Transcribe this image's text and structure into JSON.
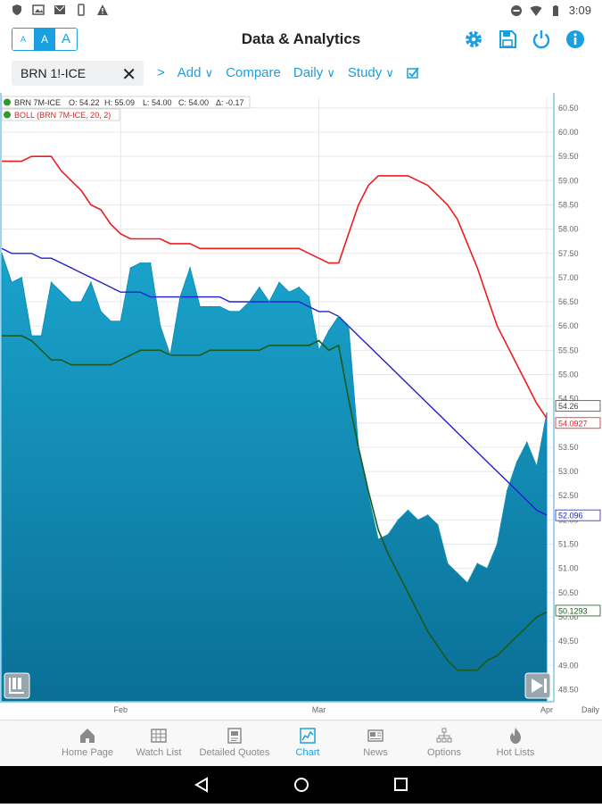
{
  "status_bar": {
    "time": "3:09"
  },
  "app": {
    "title": "Data & Analytics",
    "font_sizes": [
      "A",
      "A",
      "A"
    ],
    "actions": [
      "gear-icon",
      "save-icon",
      "power-icon",
      "info-icon"
    ]
  },
  "toolbar": {
    "symbol_value": "BRN 1!-ICE",
    "next_label": ">",
    "add_label": "Add",
    "compare_label": "Compare",
    "interval_label": "Daily",
    "study_label": "Study"
  },
  "chart": {
    "legend": [
      {
        "label": "BRN 7M-ICE",
        "o": "O: 54.22",
        "h": "H: 55.09",
        "l": "L: 54.00",
        "c": "C: 54.00",
        "chg": "Δ: -0.17",
        "color": "#222222"
      },
      {
        "label": "BOLL (BRN 7M-ICE, 20, 2)",
        "color": "#e02020"
      }
    ],
    "y_ticks": [
      "60.50",
      "60.00",
      "59.50",
      "59.00",
      "58.50",
      "58.00",
      "57.50",
      "57.00",
      "56.50",
      "56.00",
      "55.50",
      "55.00",
      "54.50",
      "54.00",
      "53.50",
      "53.00",
      "52.50",
      "52.00",
      "51.50",
      "51.00",
      "50.50",
      "50.00",
      "49.50",
      "49.00",
      "48.50"
    ],
    "x_ticks": [
      "Feb",
      "Mar",
      "Apr"
    ],
    "interval_tag": "Daily",
    "price_tags": {
      "last": "54.26",
      "upper": "54.0927",
      "middle": "52.096",
      "lower": "50.1293"
    },
    "colors": {
      "area": "#1aa3cc",
      "upper": "#ee1c1c",
      "middle": "#2020d0",
      "lower": "#1a5a1a"
    }
  },
  "chart_data": {
    "type": "area",
    "x": [
      "Jan 16",
      "Jan 17",
      "Jan 18",
      "Jan 19",
      "Jan 20",
      "Jan 23",
      "Jan 24",
      "Jan 25",
      "Jan 26",
      "Jan 27",
      "Jan 30",
      "Jan 31",
      "Feb 1",
      "Feb 2",
      "Feb 3",
      "Feb 6",
      "Feb 7",
      "Feb 8",
      "Feb 9",
      "Feb 10",
      "Feb 13",
      "Feb 14",
      "Feb 15",
      "Feb 16",
      "Feb 17",
      "Feb 20",
      "Feb 21",
      "Feb 22",
      "Feb 23",
      "Feb 24",
      "Feb 27",
      "Feb 28",
      "Mar 1",
      "Mar 2",
      "Mar 3",
      "Mar 6",
      "Mar 7",
      "Mar 8",
      "Mar 9",
      "Mar 10",
      "Mar 13",
      "Mar 14",
      "Mar 15",
      "Mar 16",
      "Mar 17",
      "Mar 20",
      "Mar 21",
      "Mar 22",
      "Mar 23",
      "Mar 24",
      "Mar 27",
      "Mar 28",
      "Mar 29",
      "Mar 30",
      "Mar 31",
      "Apr 3"
    ],
    "series": [
      {
        "name": "BRN 7M-ICE",
        "values": [
          57.5,
          56.9,
          57.0,
          55.8,
          55.8,
          56.9,
          56.7,
          56.5,
          56.5,
          56.9,
          56.3,
          56.1,
          56.1,
          57.2,
          57.3,
          57.3,
          56.0,
          55.4,
          56.6,
          57.2,
          56.4,
          56.4,
          56.4,
          56.3,
          56.3,
          56.5,
          56.8,
          56.5,
          56.9,
          56.7,
          56.8,
          56.6,
          55.5,
          55.9,
          56.2,
          56.0,
          53.5,
          52.5,
          51.6,
          51.7,
          52.0,
          52.2,
          52.0,
          52.1,
          51.9,
          51.1,
          50.9,
          50.7,
          51.1,
          51.0,
          51.5,
          52.6,
          53.2,
          53.6,
          53.1,
          54.2
        ]
      },
      {
        "name": "BOLL upper",
        "values": [
          59.4,
          59.4,
          59.4,
          59.5,
          59.5,
          59.5,
          59.2,
          59.0,
          58.8,
          58.5,
          58.4,
          58.1,
          57.9,
          57.8,
          57.8,
          57.8,
          57.8,
          57.7,
          57.7,
          57.7,
          57.6,
          57.6,
          57.6,
          57.6,
          57.6,
          57.6,
          57.6,
          57.6,
          57.6,
          57.6,
          57.6,
          57.5,
          57.4,
          57.3,
          57.3,
          57.9,
          58.5,
          58.9,
          59.1,
          59.1,
          59.1,
          59.1,
          59.0,
          58.9,
          58.7,
          58.5,
          58.2,
          57.7,
          57.2,
          56.6,
          56.0,
          55.6,
          55.2,
          54.8,
          54.4,
          54.1
        ]
      },
      {
        "name": "BOLL middle",
        "values": [
          57.6,
          57.5,
          57.5,
          57.5,
          57.4,
          57.4,
          57.3,
          57.2,
          57.1,
          57.0,
          56.9,
          56.8,
          56.7,
          56.7,
          56.7,
          56.6,
          56.6,
          56.6,
          56.6,
          56.6,
          56.6,
          56.6,
          56.6,
          56.5,
          56.5,
          56.5,
          56.5,
          56.5,
          56.5,
          56.5,
          56.5,
          56.4,
          56.3,
          56.3,
          56.2,
          56.0,
          55.8,
          55.6,
          55.4,
          55.2,
          55.0,
          54.8,
          54.6,
          54.4,
          54.2,
          54.0,
          53.8,
          53.6,
          53.4,
          53.2,
          53.0,
          52.8,
          52.6,
          52.4,
          52.2,
          52.1
        ]
      },
      {
        "name": "BOLL lower",
        "values": [
          55.8,
          55.8,
          55.8,
          55.7,
          55.5,
          55.3,
          55.3,
          55.2,
          55.2,
          55.2,
          55.2,
          55.2,
          55.3,
          55.4,
          55.5,
          55.5,
          55.5,
          55.4,
          55.4,
          55.4,
          55.4,
          55.5,
          55.5,
          55.5,
          55.5,
          55.5,
          55.5,
          55.6,
          55.6,
          55.6,
          55.6,
          55.6,
          55.7,
          55.5,
          55.6,
          54.5,
          53.5,
          52.6,
          51.8,
          51.3,
          50.9,
          50.5,
          50.1,
          49.7,
          49.4,
          49.1,
          48.9,
          48.9,
          48.9,
          49.1,
          49.2,
          49.4,
          49.6,
          49.8,
          50.0,
          50.1
        ]
      }
    ],
    "ylim": [
      48.25,
      60.7
    ],
    "grid": true,
    "xlabel": "",
    "ylabel": ""
  },
  "bottom_nav": [
    {
      "label": "Home Page",
      "icon": "home-icon"
    },
    {
      "label": "Watch List",
      "icon": "grid-icon"
    },
    {
      "label": "Detailed Quotes",
      "icon": "document-icon"
    },
    {
      "label": "Chart",
      "icon": "chart-icon",
      "active": true
    },
    {
      "label": "News",
      "icon": "news-icon"
    },
    {
      "label": "Options",
      "icon": "tree-icon"
    },
    {
      "label": "Hot Lists",
      "icon": "flame-icon"
    }
  ]
}
